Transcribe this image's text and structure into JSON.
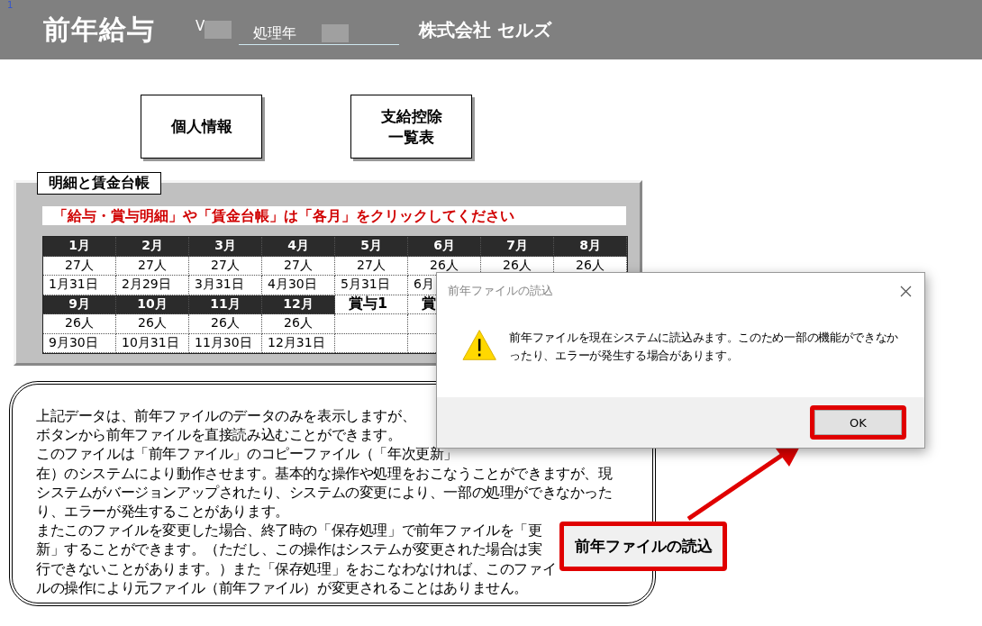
{
  "marker": "1",
  "header": {
    "title": "前年給与",
    "version_label": "V",
    "year_field": {
      "label": "処理年"
    },
    "company": "株式会社 セルズ"
  },
  "menu_buttons": [
    {
      "lines": [
        "個人情報"
      ]
    },
    {
      "lines": [
        "支給控除",
        "一覧表"
      ]
    }
  ],
  "ledger": {
    "title": "明細と賃金台帳",
    "instruction": "「給与・賞与明細」や「賃金台帳」は「各月」をクリックしてください",
    "blocks": [
      {
        "cells": [
          {
            "kind": "month",
            "header": "1月",
            "count": "27人",
            "date": "1月31日"
          },
          {
            "kind": "month",
            "header": "2月",
            "count": "27人",
            "date": "2月29日"
          },
          {
            "kind": "month",
            "header": "3月",
            "count": "27人",
            "date": "3月31日"
          },
          {
            "kind": "month",
            "header": "4月",
            "count": "27人",
            "date": "4月30日"
          },
          {
            "kind": "month",
            "header": "5月",
            "count": "27人",
            "date": "5月31日"
          },
          {
            "kind": "month",
            "header": "6月",
            "count": "26人",
            "date": "6月"
          },
          {
            "kind": "month",
            "header": "7月",
            "count": "26人"
          },
          {
            "kind": "month",
            "header": "8月",
            "count": "26人"
          }
        ]
      },
      {
        "cells": [
          {
            "kind": "month",
            "header": "9月",
            "count": "26人",
            "date": "9月30日"
          },
          {
            "kind": "month",
            "header": "10月",
            "count": "26人",
            "date": "10月31日"
          },
          {
            "kind": "month",
            "header": "11月",
            "count": "26人",
            "date": "11月30日"
          },
          {
            "kind": "month",
            "header": "12月",
            "count": "26人",
            "date": "12月31日"
          },
          {
            "kind": "bonus",
            "header": "賞与1"
          },
          {
            "kind": "bonus",
            "header": "賞"
          },
          {
            "kind": "bonus"
          },
          {
            "kind": "bonus"
          }
        ]
      }
    ]
  },
  "notice": {
    "lines": [
      "上記データは、前年ファイルのデータのみを表示しますが、",
      "ボタンから前年ファイルを直接読み込むことができます。",
      "このファイルは「前年ファイル」のコピーファイル（「年次更新」",
      "在）のシステムにより動作させます。基本的な操作や処理をおこなうことができますが、現",
      "システムがバージョンアップされたり、システムの変更により、一部の処理ができなかった",
      "り、エラーが発生することがあります。",
      "またこのファイルを変更した場合、終了時の「保存処理」で前年ファイルを「更",
      "新」することができます。（ただし、この操作はシステムが変更された場合は実",
      "行できないことがあります。）また「保存処理」をおこなわなければ、このファイ",
      "ルの操作により元ファイル（前年ファイル）が変更されることはありません。"
    ],
    "load_button": {
      "label": "前年ファイルの読込"
    }
  },
  "dialog": {
    "title": "前年ファイルの読込",
    "message": "前年ファイルを現在システムに読込みます。このため一部の機能ができなかったり、エラーが発生する場合があります。",
    "ok_button": "OK"
  }
}
